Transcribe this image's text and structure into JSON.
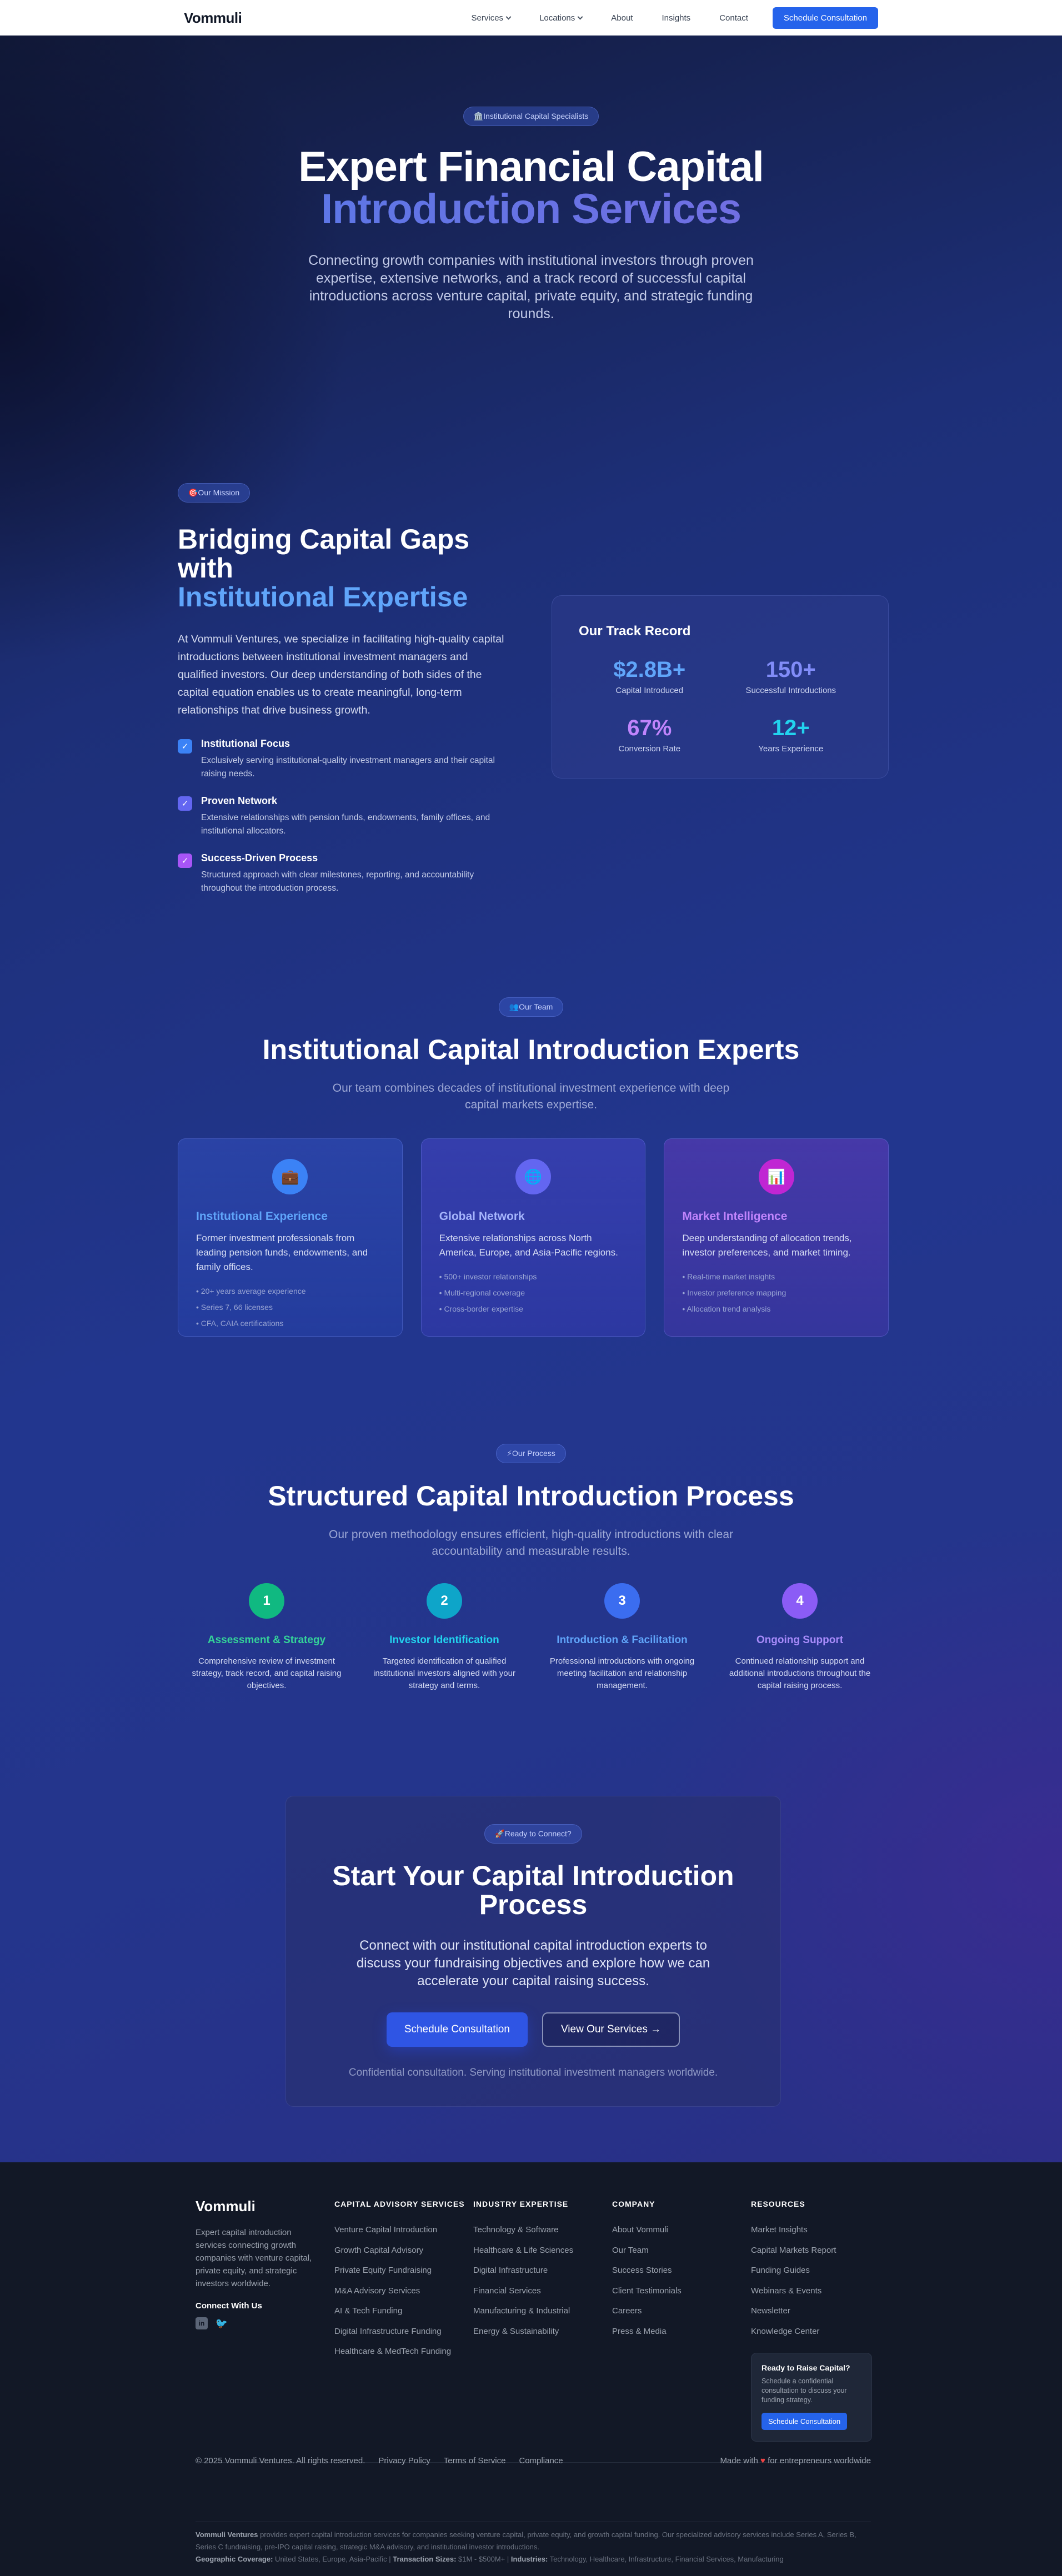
{
  "nav": {
    "logo": "Vommuli",
    "links": [
      "Services",
      "Locations",
      "About",
      "Insights",
      "Contact"
    ],
    "cta": "Schedule Consultation"
  },
  "hero": {
    "badge": "🏛️Institutional Capital Specialists",
    "title_line1": "Expert Financial Capital",
    "title_line2": "Introduction Services",
    "subtitle": "Connecting growth companies with institutional investors through proven expertise, extensive networks, and a track record of successful capital introductions across venture capital, private equity, and strategic funding rounds."
  },
  "mission": {
    "badge": "🎯Our Mission",
    "title_line1": "Bridging Capital Gaps with",
    "title_line2": "Institutional Expertise",
    "lead": "At Vommuli Ventures, we specialize in facilitating high-quality capital introductions between institutional investment managers and qualified investors. Our deep understanding of both sides of the capital equation enables us to create meaningful, long-term relationships that drive business growth.",
    "features": [
      {
        "title": "Institutional Focus",
        "text": "Exclusively serving institutional-quality investment managers and their capital raising needs."
      },
      {
        "title": "Proven Network",
        "text": "Extensive relationships with pension funds, endowments, family offices, and institutional allocators."
      },
      {
        "title": "Success-Driven Process",
        "text": "Structured approach with clear milestones, reporting, and accountability throughout the introduction process."
      }
    ]
  },
  "track": {
    "title": "Our Track Record",
    "stats": [
      {
        "value": "$2.8B+",
        "label": "Capital Introduced",
        "color": "#60a5fa"
      },
      {
        "value": "150+",
        "label": "Successful Introductions",
        "color": "#818cf8"
      },
      {
        "value": "67%",
        "label": "Conversion Rate",
        "color": "#c084fc"
      },
      {
        "value": "12+",
        "label": "Years Experience",
        "color": "#22d3ee"
      }
    ]
  },
  "team": {
    "badge": "👥Our Team",
    "title": "Institutional Capital Introduction Experts",
    "subtitle": "Our team combines decades of institutional investment experience with deep capital markets expertise.",
    "cards": [
      {
        "icon": "briefcase-icon",
        "glyph": "💼",
        "title": "Institutional Experience",
        "text": "Former investment professionals from leading pension funds, endowments, and family offices.",
        "items": [
          "• 20+ years average experience",
          "• Series 7, 66 licenses",
          "• CFA, CAIA certifications"
        ],
        "accent": "#60a5fa"
      },
      {
        "icon": "globe-icon",
        "glyph": "🌐",
        "title": "Global Network",
        "text": "Extensive relationships across North America, Europe, and Asia-Pacific regions.",
        "items": [
          "• 500+ investor relationships",
          "• Multi-regional coverage",
          "• Cross-border expertise"
        ],
        "accent": "#a5b4fc"
      },
      {
        "icon": "chart-icon",
        "glyph": "📊",
        "title": "Market Intelligence",
        "text": "Deep understanding of allocation trends, investor preferences, and market timing.",
        "items": [
          "• Real-time market insights",
          "• Investor preference mapping",
          "• Allocation trend analysis"
        ],
        "accent": "#c084fc"
      }
    ]
  },
  "process": {
    "badge": "⚡Our Process",
    "title": "Structured Capital Introduction Process",
    "subtitle": "Our proven methodology ensures efficient, high-quality introductions with clear accountability and measurable results.",
    "steps": [
      {
        "num": "1",
        "title": "Assessment & Strategy",
        "text": "Comprehensive review of investment strategy, track record, and capital raising objectives.",
        "color": "#10b981",
        "title_color": "#34d399"
      },
      {
        "num": "2",
        "title": "Investor Identification",
        "text": "Targeted identification of qualified institutional investors aligned with your strategy and terms.",
        "color": "#0ea5c9",
        "title_color": "#22d3ee"
      },
      {
        "num": "3",
        "title": "Introduction & Facilitation",
        "text": "Professional introductions with ongoing meeting facilitation and relationship management.",
        "color": "#3b6df0",
        "title_color": "#60a5fa"
      },
      {
        "num": "4",
        "title": "Ongoing Support",
        "text": "Continued relationship support and additional introductions throughout the capital raising process.",
        "color": "#8b5cf6",
        "title_color": "#a78bfa"
      }
    ]
  },
  "cta": {
    "badge": "🚀Ready to Connect?",
    "title": "Start Your Capital Introduction Process",
    "lead": "Connect with our institutional capital introduction experts to discuss your fundraising objectives and explore how we can accelerate your capital raising success.",
    "primary": "Schedule Consultation",
    "secondary": "View Our Services",
    "fine": "Confidential consultation. Serving institutional investment managers worldwide."
  },
  "footer": {
    "logo": "Vommuli",
    "desc": "Expert capital introduction services connecting growth companies with venture capital, private equity, and strategic investors worldwide.",
    "connect": "Connect With Us",
    "cols": [
      {
        "title": "CAPITAL ADVISORY SERVICES",
        "items": [
          "Venture Capital Introduction",
          "Growth Capital Advisory",
          "Private Equity Fundraising",
          "M&A Advisory Services",
          "AI & Tech Funding",
          "Digital Infrastructure Funding",
          "Healthcare & MedTech Funding"
        ]
      },
      {
        "title": "INDUSTRY EXPERTISE",
        "items": [
          "Technology & Software",
          "Healthcare & Life Sciences",
          "Digital Infrastructure",
          "Financial Services",
          "Manufacturing & Industrial",
          "Energy & Sustainability"
        ]
      },
      {
        "title": "COMPANY",
        "items": [
          "About Vommuli",
          "Our Team",
          "Success Stories",
          "Client Testimonials",
          "Careers",
          "Press & Media"
        ]
      },
      {
        "title": "RESOURCES",
        "items": [
          "Market Insights",
          "Capital Markets Report",
          "Funding Guides",
          "Webinars & Events",
          "Newsletter",
          "Knowledge Center"
        ]
      }
    ],
    "ready": {
      "title": "Ready to Raise Capital?",
      "text": "Schedule a confidential consultation to discuss your funding strategy.",
      "button": "Schedule Consultation"
    },
    "copyright": "© 2025 Vommuli Ventures. All rights reserved.",
    "legal": [
      "Privacy Policy",
      "Terms of Service",
      "Compliance"
    ],
    "made_pre": "Made with",
    "made_post": "for entrepreneurs worldwide",
    "fine_brand": "Vommuli Ventures",
    "fine_text": " provides expert capital introduction services for companies seeking venture capital, private equity, and growth capital funding. Our specialized advisory services include Series A, Series B, Series C fundraising, pre-IPO capital raising, strategic M&A advisory, and institutional investor introductions.",
    "geo_label": "Geographic Coverage:",
    "geo": " United States, Europe, Asia-Pacific | ",
    "size_label": "Transaction Sizes:",
    "size": " $1M - $500M+ | ",
    "ind_label": "Industries:",
    "ind": " Technology, Healthcare, Infrastructure, Financial Services, Manufacturing"
  }
}
